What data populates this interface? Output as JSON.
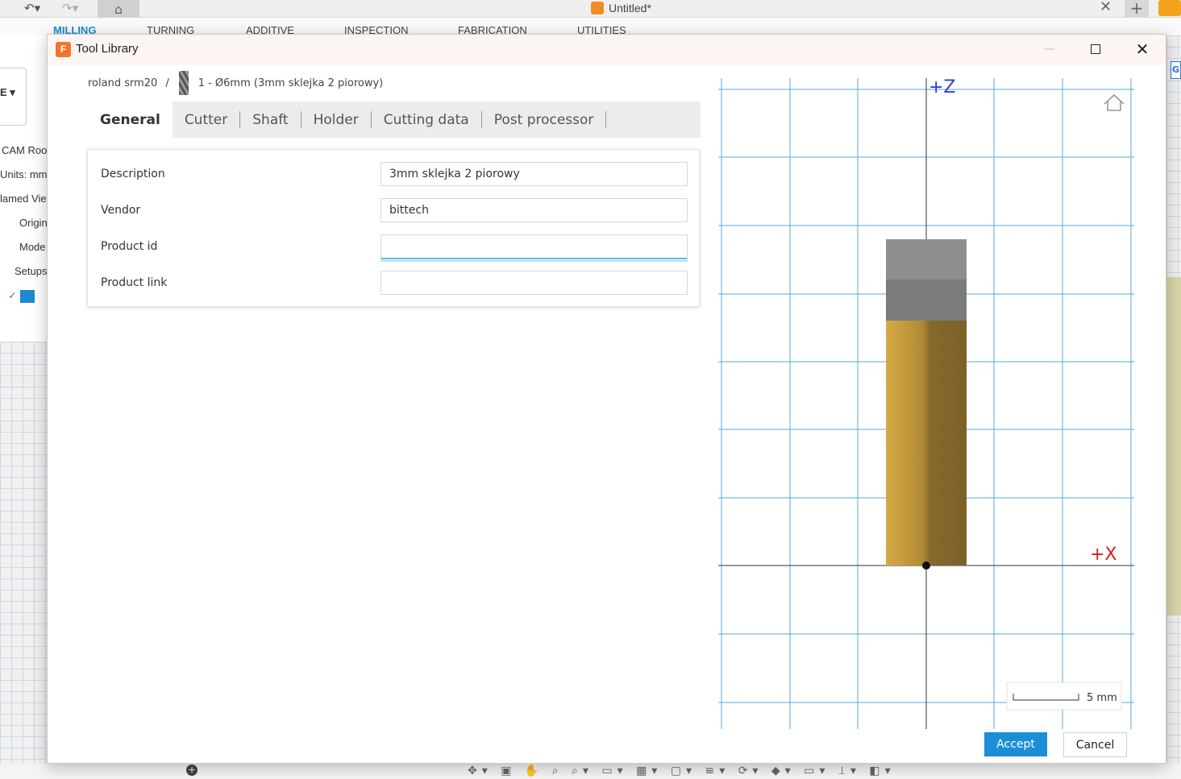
{
  "app": {
    "doc_title": "Untitled*",
    "ribbon_tabs": [
      "MILLING",
      "TURNING",
      "ADDITIVE",
      "INSPECTION",
      "FABRICATION",
      "UTILITIES"
    ],
    "design_dropdown": "E",
    "browser_items": [
      "CAM Roo",
      "Units: mm",
      "lamed Vie",
      "Origin",
      "Mode",
      "Setups"
    ]
  },
  "dialog": {
    "title": "Tool Library",
    "app_icon_letter": "F"
  },
  "breadcrumb": {
    "library": "roland srm20",
    "separator": "/",
    "tool": "1 - Ø6mm (3mm sklejka 2 piorowy)"
  },
  "tabs": [
    {
      "label": "General",
      "active": true
    },
    {
      "label": "Cutter",
      "active": false
    },
    {
      "label": "Shaft",
      "active": false
    },
    {
      "label": "Holder",
      "active": false
    },
    {
      "label": "Cutting data",
      "active": false
    },
    {
      "label": "Post processor",
      "active": false
    }
  ],
  "form": {
    "description_label": "Description",
    "description_value": "3mm sklejka 2 piorowy",
    "vendor_label": "Vendor",
    "vendor_value": "bittech",
    "product_id_label": "Product id",
    "product_id_value": "",
    "product_link_label": "Product link",
    "product_link_value": ""
  },
  "preview": {
    "z_axis_label": "+Z",
    "x_axis_label": "+X",
    "scale_label": "5 mm",
    "grid_color": "#56a8df",
    "holder_color": "#8a8a8a",
    "body_color": "#b08a2e",
    "axis_label_colors": {
      "z": "#2b3fd6",
      "x": "#d42020"
    }
  },
  "buttons": {
    "accept": "Accept",
    "cancel": "Cancel"
  },
  "colors": {
    "accent": "#1a8fd8"
  }
}
